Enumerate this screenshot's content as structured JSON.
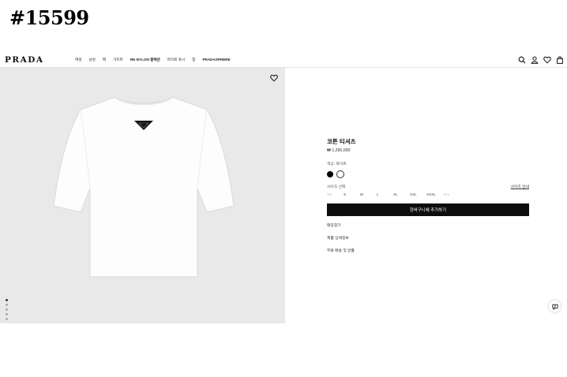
{
  "overlay": {
    "tag": "#15599"
  },
  "header": {
    "logo": "PRADA",
    "nav": [
      "여성",
      "남성",
      "백",
      "가즈트",
      "RE-NYLON 컬렉션",
      "라이프 쥬시",
      "참",
      "PRADASPHERE"
    ],
    "icons": [
      "search-icon",
      "account-icon",
      "wishlist-icon",
      "bag-icon"
    ]
  },
  "gallery": {
    "icons": [
      "heart-icon"
    ],
    "image_count": 5,
    "active_index": 0,
    "background": "#e9e9e9"
  },
  "product": {
    "title": "코튼 티셔츠",
    "price": "₩ 1,290,000",
    "color_label": "색상: 화이트",
    "colors": [
      "#000000",
      "#ffffff"
    ],
    "size_label": "사이즈 선택",
    "size_guide": "사이즈 안내",
    "sizes": [
      "XS",
      "S",
      "M",
      "L",
      "XL",
      "XXL",
      "XXXL",
      "4XL"
    ],
    "unavailable_sizes": [
      "XS",
      "4XL"
    ],
    "add_to_cart": "장바구니에 추가하기",
    "links": [
      "매장찾기",
      "제품 상세정보",
      "무료 배송 및 반품"
    ]
  },
  "chat": {
    "icon": "chat-icon"
  }
}
